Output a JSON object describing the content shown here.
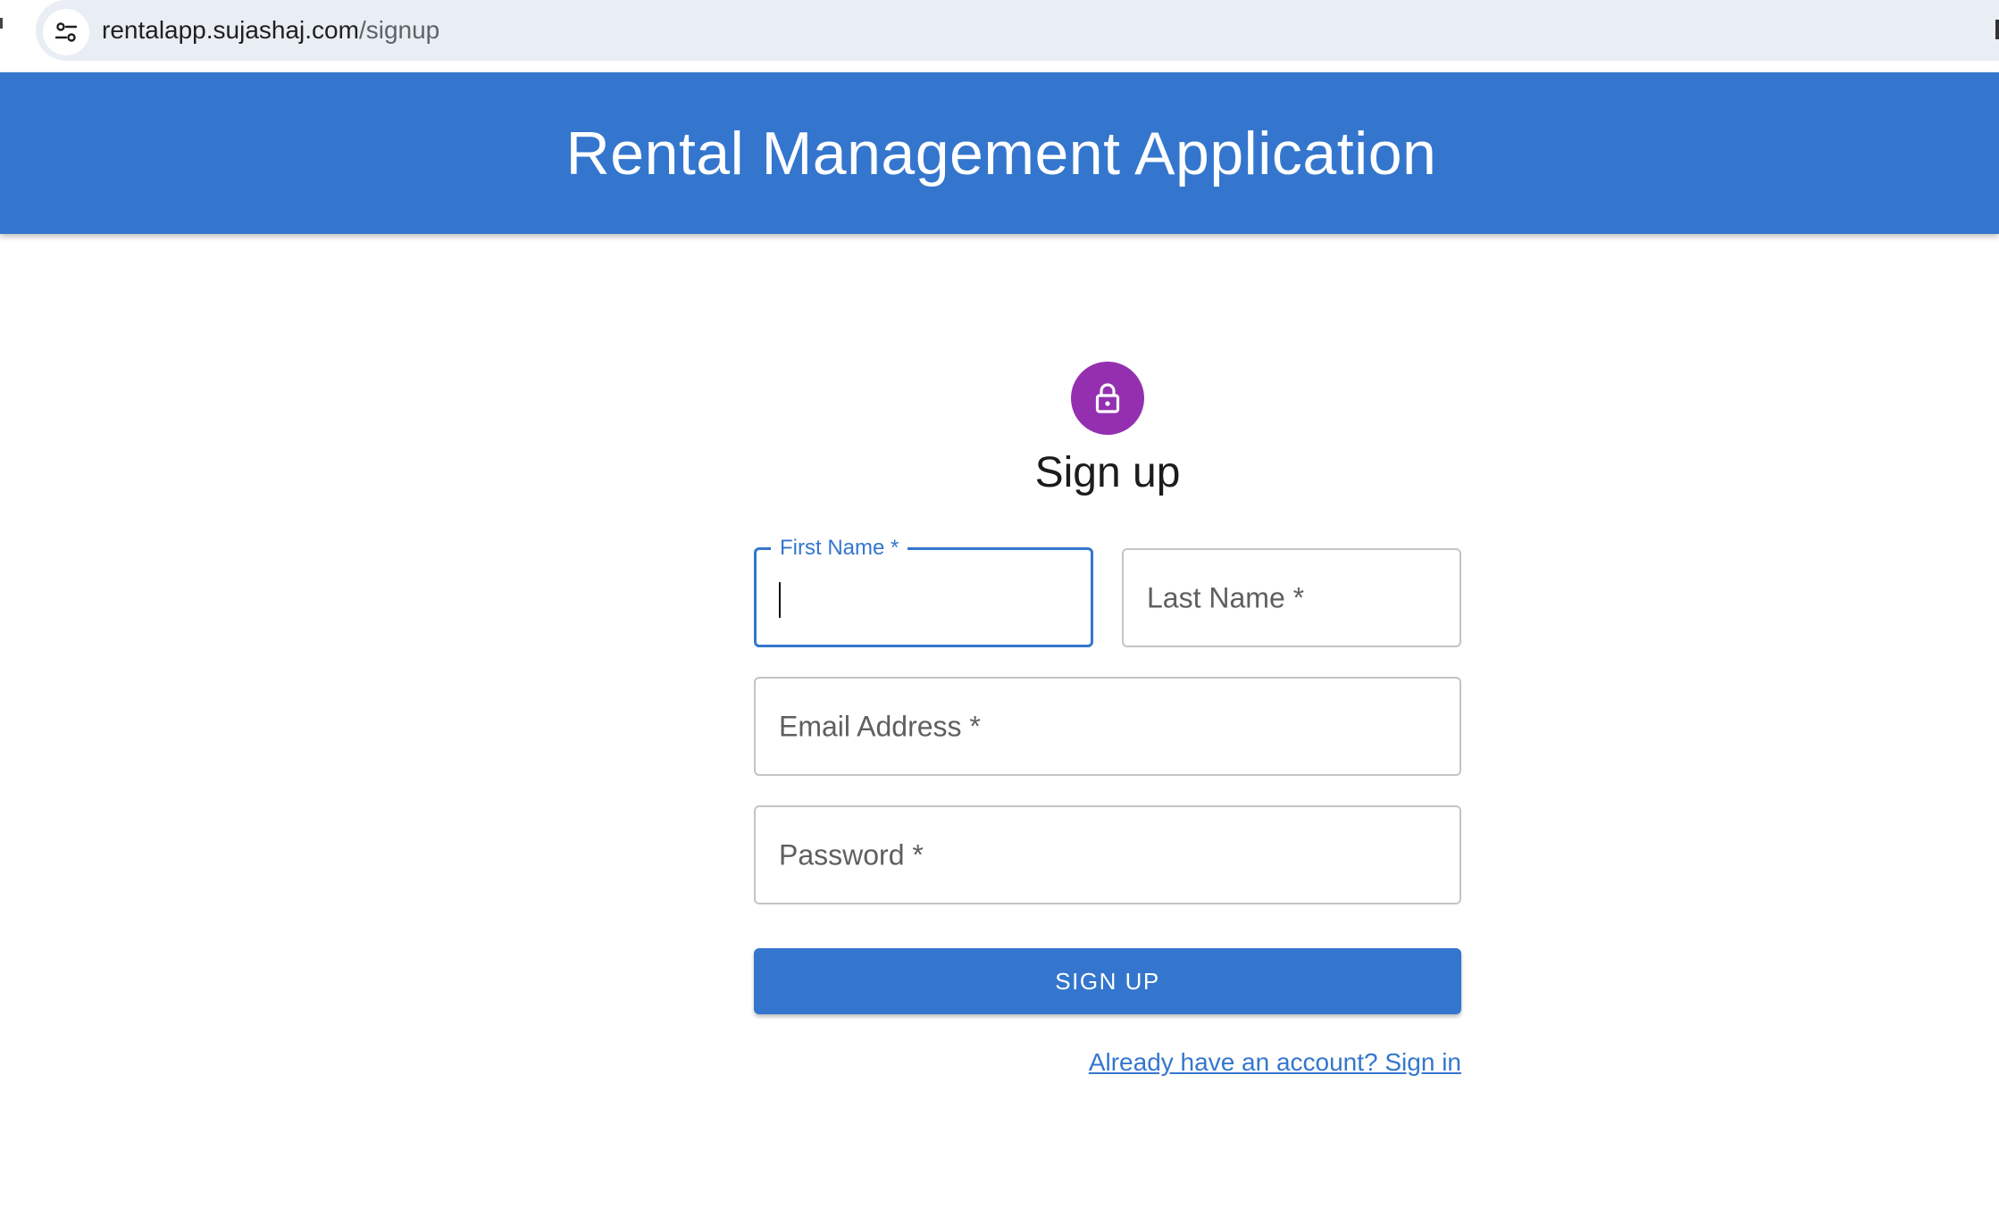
{
  "browser": {
    "url_host": "rentalapp.sujashaj.com",
    "url_path": "/signup",
    "site_info_icon": "tune-icon"
  },
  "header": {
    "title": "Rental Management Application",
    "background_color": "#3476cd"
  },
  "form": {
    "avatar_icon": "lock-icon",
    "avatar_color": "#9430b0",
    "title": "Sign up",
    "fields": {
      "first_name": {
        "label": "First Name *",
        "value": "",
        "focused": true
      },
      "last_name": {
        "label": "Last Name *",
        "value": ""
      },
      "email": {
        "label": "Email Address *",
        "value": ""
      },
      "password": {
        "label": "Password *",
        "value": ""
      }
    },
    "submit_label": "SIGN UP",
    "signin_link": "Already have an account? Sign in"
  }
}
